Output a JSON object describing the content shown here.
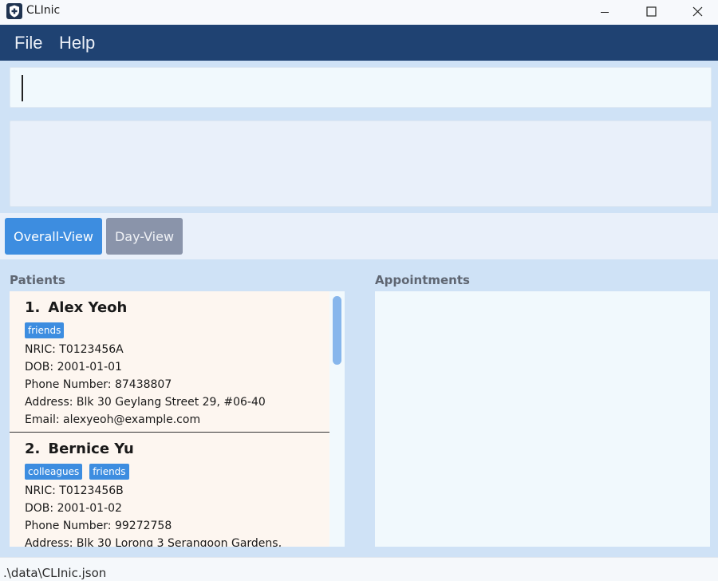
{
  "window": {
    "title": "CLInic",
    "icon": "shield-plus-icon"
  },
  "menu": {
    "items": [
      {
        "label": "File"
      },
      {
        "label": "Help"
      }
    ]
  },
  "command": {
    "value": ""
  },
  "result": {
    "text": ""
  },
  "views": {
    "overall_label": "Overall-View",
    "day_label": "Day-View",
    "active": "Overall-View",
    "colors": {
      "active": "#3d8de0",
      "inactive": "#8a94aa"
    }
  },
  "patients": {
    "label": "Patients",
    "items": [
      {
        "index": "1.",
        "name": "Alex Yeoh",
        "tags": [
          "friends"
        ],
        "nric": "NRIC: T0123456A",
        "dob": "DOB: 2001-01-01",
        "phone": "Phone Number: 87438807",
        "address": "Address: Blk 30 Geylang Street 29, #06-40",
        "email": "Email: alexyeoh@example.com"
      },
      {
        "index": "2.",
        "name": "Bernice Yu",
        "tags": [
          "colleagues",
          "friends"
        ],
        "nric": "NRIC: T0123456B",
        "dob": "DOB: 2001-01-02",
        "phone": "Phone Number: 99272758",
        "address": "Address: Blk 30 Lorong 3 Serangoon Gardens,"
      }
    ]
  },
  "appointments": {
    "label": "Appointments",
    "items": []
  },
  "status": {
    "path": ".\\data\\CLInic.json"
  },
  "colors": {
    "menubar": "#1f4272",
    "background": "#cfe2f6",
    "tag": "#3d8de0",
    "card": "#fdf6f0"
  }
}
